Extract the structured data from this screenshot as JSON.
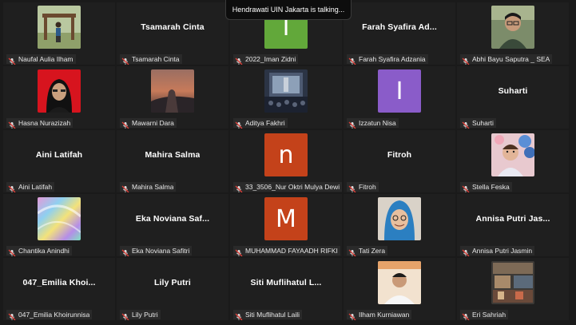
{
  "notification": {
    "text": "Hendrawati UIN Jakarta is talking..."
  },
  "colors": {
    "green": "#62a83a",
    "purple": "#8a5cc9",
    "orange": "#c4421a",
    "tile": "#1f1f1f"
  },
  "participants": [
    {
      "label": "Naufal Aulia Ilham",
      "kind": "photo",
      "photo": "park"
    },
    {
      "label": "Tsamarah Cinta",
      "kind": "name",
      "display": "Tsamarah Cinta"
    },
    {
      "label": "2022_Iman Zidni",
      "kind": "letter",
      "letter": "I",
      "color": "#62a83a"
    },
    {
      "label": "Farah Syafira Adzania",
      "kind": "name",
      "display": "Farah Syafira Ad..."
    },
    {
      "label": "Abhi Bayu Saputra _ SEA",
      "kind": "photo",
      "photo": "man-glasses"
    },
    {
      "label": "Hasna Nurazizah",
      "kind": "photo",
      "photo": "hijab-red"
    },
    {
      "label": "Mawarni Dara",
      "kind": "photo",
      "photo": "sunset-hand"
    },
    {
      "label": "Aditya Fakhri",
      "kind": "photo",
      "photo": "concert"
    },
    {
      "label": "Izzatun Nisa",
      "kind": "letter",
      "letter": "I",
      "color": "#8a5cc9"
    },
    {
      "label": "Suharti",
      "kind": "name",
      "display": "Suharti"
    },
    {
      "label": "Aini Latifah",
      "kind": "name",
      "display": "Aini Latifah"
    },
    {
      "label": "Mahira Salma",
      "kind": "name",
      "display": "Mahira Salma"
    },
    {
      "label": "33_3506_Nur Oktri Mulya Dewi",
      "kind": "letter",
      "letter": "n",
      "color": "#c4421a"
    },
    {
      "label": "Fitroh",
      "kind": "name",
      "display": "Fitroh"
    },
    {
      "label": "Stella Feska",
      "kind": "photo",
      "photo": "baby-balloons"
    },
    {
      "label": "Chantika Anindhi",
      "kind": "photo",
      "photo": "holo"
    },
    {
      "label": "Eka Noviana Safitri",
      "kind": "name",
      "display": "Eka  Noviana  Saf..."
    },
    {
      "label": "MUHAMMAD FAYAADH RIFKI",
      "kind": "letter",
      "letter": "M",
      "color": "#c4421a"
    },
    {
      "label": "Tati Zera",
      "kind": "photo",
      "photo": "hijab-blue"
    },
    {
      "label": "Annisa Putri Jasmin",
      "kind": "name",
      "display": "Annisa Putri Jas..."
    },
    {
      "label": "047_Emilia Khoirunnisa",
      "kind": "name",
      "display": "047_Emilia  Khoi..."
    },
    {
      "label": "Lily Putri",
      "kind": "name",
      "display": "Lily Putri"
    },
    {
      "label": "Siti Muflihatul Laili",
      "kind": "name",
      "display": "Siti  Muflihatul  L..."
    },
    {
      "label": "Ilham Kurniawan",
      "kind": "photo",
      "photo": "man-orange"
    },
    {
      "label": "Eri Sahriah",
      "kind": "photo",
      "photo": "shop"
    }
  ]
}
